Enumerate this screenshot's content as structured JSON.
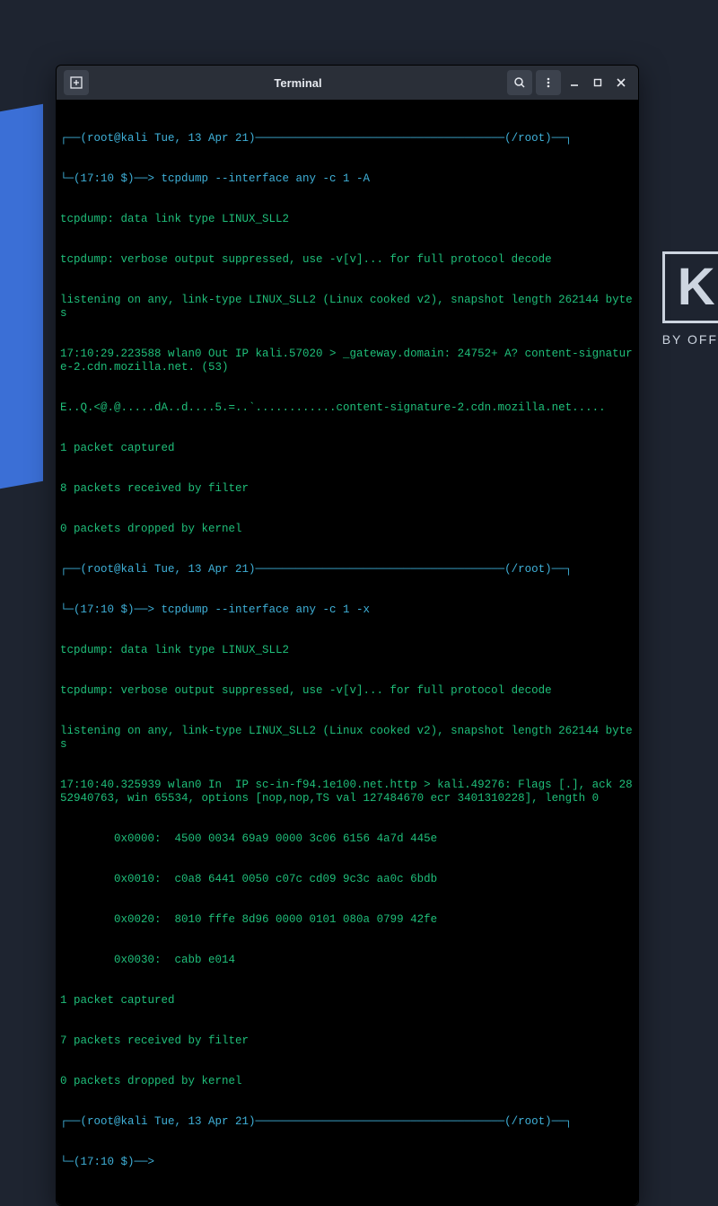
{
  "window": {
    "title": "Terminal"
  },
  "prompt1": {
    "top": "┌──(root@kali Tue, 13 Apr 21)─────────────────────────────────────(/root)──┐",
    "bot": "└─(17:10 $)──> tcpdump --interface any -c 1 -A"
  },
  "out1": [
    "tcpdump: data link type LINUX_SLL2",
    "tcpdump: verbose output suppressed, use -v[v]... for full protocol decode",
    "listening on any, link-type LINUX_SLL2 (Linux cooked v2), snapshot length 262144 bytes",
    "17:10:29.223588 wlan0 Out IP kali.57020 > _gateway.domain: 24752+ A? content-signature-2.cdn.mozilla.net. (53)",
    "E..Q.<@.@.....dA..d....5.=..`............content-signature-2.cdn.mozilla.net.....",
    "1 packet captured",
    "8 packets received by filter",
    "0 packets dropped by kernel"
  ],
  "prompt2": {
    "top": "┌──(root@kali Tue, 13 Apr 21)─────────────────────────────────────(/root)──┐",
    "bot": "└─(17:10 $)──> tcpdump --interface any -c 1 -x"
  },
  "out2": [
    "tcpdump: data link type LINUX_SLL2",
    "tcpdump: verbose output suppressed, use -v[v]... for full protocol decode",
    "listening on any, link-type LINUX_SLL2 (Linux cooked v2), snapshot length 262144 bytes",
    "17:10:40.325939 wlan0 In  IP sc-in-f94.1e100.net.http > kali.49276: Flags [.], ack 2852940763, win 65534, options [nop,nop,TS val 127484670 ecr 3401310228], length 0",
    "        0x0000:  4500 0034 69a9 0000 3c06 6156 4a7d 445e",
    "        0x0010:  c0a8 6441 0050 c07c cd09 9c3c aa0c 6bdb",
    "        0x0020:  8010 fffe 8d96 0000 0101 080a 0799 42fe",
    "        0x0030:  cabb e014",
    "1 packet captured",
    "7 packets received by filter",
    "0 packets dropped by kernel"
  ],
  "prompt3": {
    "top": "┌──(root@kali Tue, 13 Apr 21)─────────────────────────────────────(/root)──┐",
    "bot": "└─(17:10 $)──> "
  },
  "logo": {
    "letter": "K",
    "sub": "BY OFF"
  }
}
